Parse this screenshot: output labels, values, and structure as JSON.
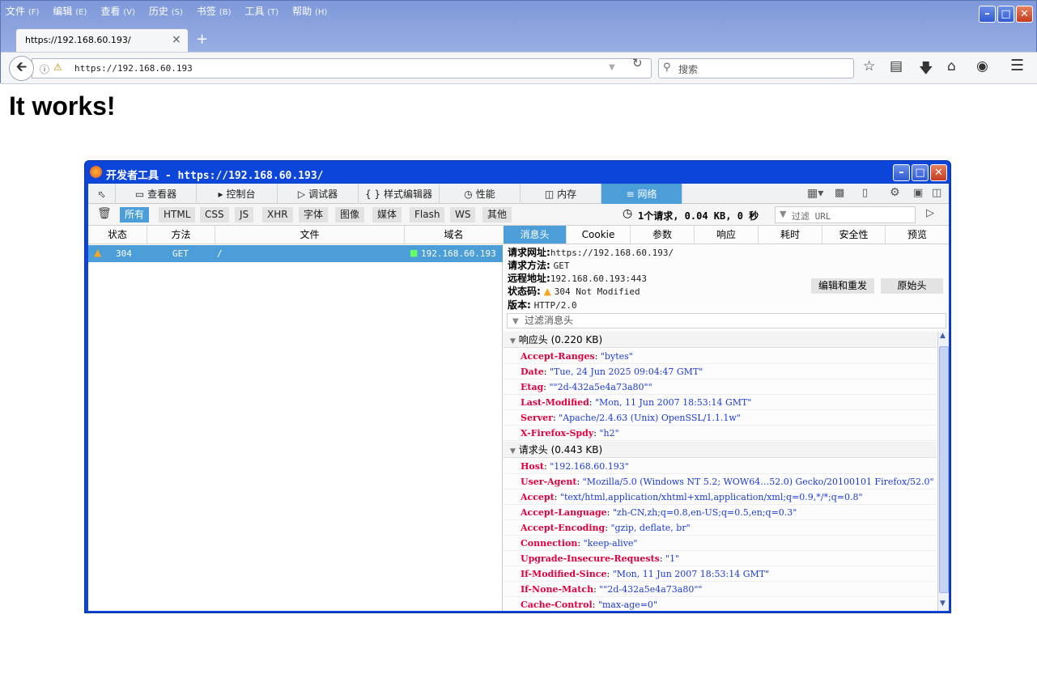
{
  "menu": [
    {
      "label": "文件",
      "key": "(F)"
    },
    {
      "label": "编辑",
      "key": "(E)"
    },
    {
      "label": "查看",
      "key": "(V)"
    },
    {
      "label": "历史",
      "key": "(S)"
    },
    {
      "label": "书签",
      "key": "(B)"
    },
    {
      "label": "工具",
      "key": "(T)"
    },
    {
      "label": "帮助",
      "key": "(H)"
    }
  ],
  "tab": {
    "title": "https://192.168.60.193/"
  },
  "navbar": {
    "url": "https://192.168.60.193",
    "search_placeholder": "搜索"
  },
  "page": {
    "heading": "It works!"
  },
  "devtools": {
    "title": "开发者工具 - https://192.168.60.193/",
    "tools": [
      "查看器",
      "控制台",
      "调试器",
      "样式编辑器",
      "性能",
      "内存",
      "网络"
    ],
    "filters": [
      "所有",
      "HTML",
      "CSS",
      "JS",
      "XHR",
      "字体",
      "图像",
      "媒体",
      "Flash",
      "WS",
      "其他"
    ],
    "summary": "1个请求, 0.04 KB, 0 秒",
    "filter_url_placeholder": "过滤 URL",
    "columns": [
      "状态",
      "方法",
      "文件",
      "域名"
    ],
    "request": {
      "status": "304",
      "method": "GET",
      "file": "/",
      "domain": "192.168.60.193"
    },
    "detail_tabs": [
      "消息头",
      "Cookie",
      "参数",
      "响应",
      "耗时",
      "安全性",
      "预览"
    ],
    "info": {
      "url_label": "请求网址:",
      "url": "https://192.168.60.193/",
      "method_label": "请求方法:",
      "method": "GET",
      "remote_label": "远程地址:",
      "remote": "192.168.60.193:443",
      "status_label": "状态码:",
      "status": "304 Not Modified",
      "version_label": "版本:",
      "version": "HTTP/2.0"
    },
    "edit_resend": "编辑和重发",
    "raw_headers": "原始头",
    "header_filter_placeholder": "过滤消息头",
    "response_section": "响应头 (0.220 KB)",
    "response_headers": [
      {
        "k": "Accept-Ranges",
        "v": "\"bytes\""
      },
      {
        "k": "Date",
        "v": "\"Tue, 24 Jun 2025 09:04:47 GMT\""
      },
      {
        "k": "Etag",
        "v": "\"\"2d-432a5e4a73a80\"\""
      },
      {
        "k": "Last-Modified",
        "v": "\"Mon, 11 Jun 2007 18:53:14 GMT\""
      },
      {
        "k": "Server",
        "v": "\"Apache/2.4.63 (Unix) OpenSSL/1.1.1w\""
      },
      {
        "k": "X-Firefox-Spdy",
        "v": "\"h2\""
      }
    ],
    "request_section": "请求头 (0.443 KB)",
    "request_headers": [
      {
        "k": "Host",
        "v": "\"192.168.60.193\""
      },
      {
        "k": "User-Agent",
        "v": "\"Mozilla/5.0 (Windows NT 5.2; WOW64…52.0) Gecko/20100101 Firefox/52.0\""
      },
      {
        "k": "Accept",
        "v": "\"text/html,application/xhtml+xml,application/xml;q=0.9,*/*;q=0.8\""
      },
      {
        "k": "Accept-Language",
        "v": "\"zh-CN,zh;q=0.8,en-US;q=0.5,en;q=0.3\""
      },
      {
        "k": "Accept-Encoding",
        "v": "\"gzip, deflate, br\""
      },
      {
        "k": "Connection",
        "v": "\"keep-alive\""
      },
      {
        "k": "Upgrade-Insecure-Requests",
        "v": "\"1\""
      },
      {
        "k": "If-Modified-Since",
        "v": "\"Mon, 11 Jun 2007 18:53:14 GMT\""
      },
      {
        "k": "If-None-Match",
        "v": "\"\"2d-432a5e4a73a80\"\""
      },
      {
        "k": "Cache-Control",
        "v": "\"max-age=0\""
      }
    ]
  }
}
